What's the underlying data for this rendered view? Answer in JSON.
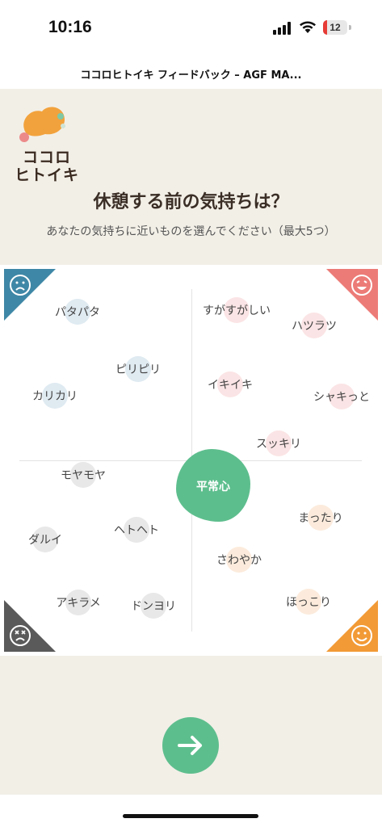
{
  "status_bar": {
    "time": "10:16",
    "battery": "12",
    "icons": [
      "signal-icon",
      "wifi-icon",
      "battery-icon"
    ]
  },
  "page": {
    "title": "ココロヒトイキ フィードバック – AGF MA..."
  },
  "header": {
    "logo_line1": "ココロ",
    "logo_line2": "ヒトイキ",
    "question": "休憩する前の気持ちは？",
    "subtitle": "あなたの気持ちに近いものを選んでください（最大5つ）"
  },
  "grid": {
    "corners": {
      "top_left": "sad-face-icon",
      "top_right": "happy-face-icon",
      "bottom_left": "dizzy-face-icon",
      "bottom_right": "smile-face-icon"
    },
    "colors": {
      "top_left": "#3f87a6",
      "top_right": "#ec7b77",
      "bottom_left": "#5a5a5a",
      "bottom_right": "#f29a36",
      "center": "#5dbe8d"
    },
    "center": "平常心",
    "moods": {
      "patapata": "パタパタ",
      "piripiri": "ピリピリ",
      "karikari": "カリカリ",
      "sugasugashii": "すがすがしい",
      "hatsuratsu": "ハツラツ",
      "ikiiki": "イキイキ",
      "shakitto": "シャキっと",
      "sukkiri": "スッキリ",
      "moyamoya": "モヤモヤ",
      "darui": "ダルイ",
      "hetoheto": "ヘトヘト",
      "akirame": "アキラメ",
      "donyori": "ドンヨリ",
      "mattari": "まったり",
      "sawayaka": "さわやか",
      "hokkori": "ほっこり"
    }
  },
  "footer": {
    "next_icon": "arrow-right-icon",
    "accent": "#5dbe8d"
  }
}
